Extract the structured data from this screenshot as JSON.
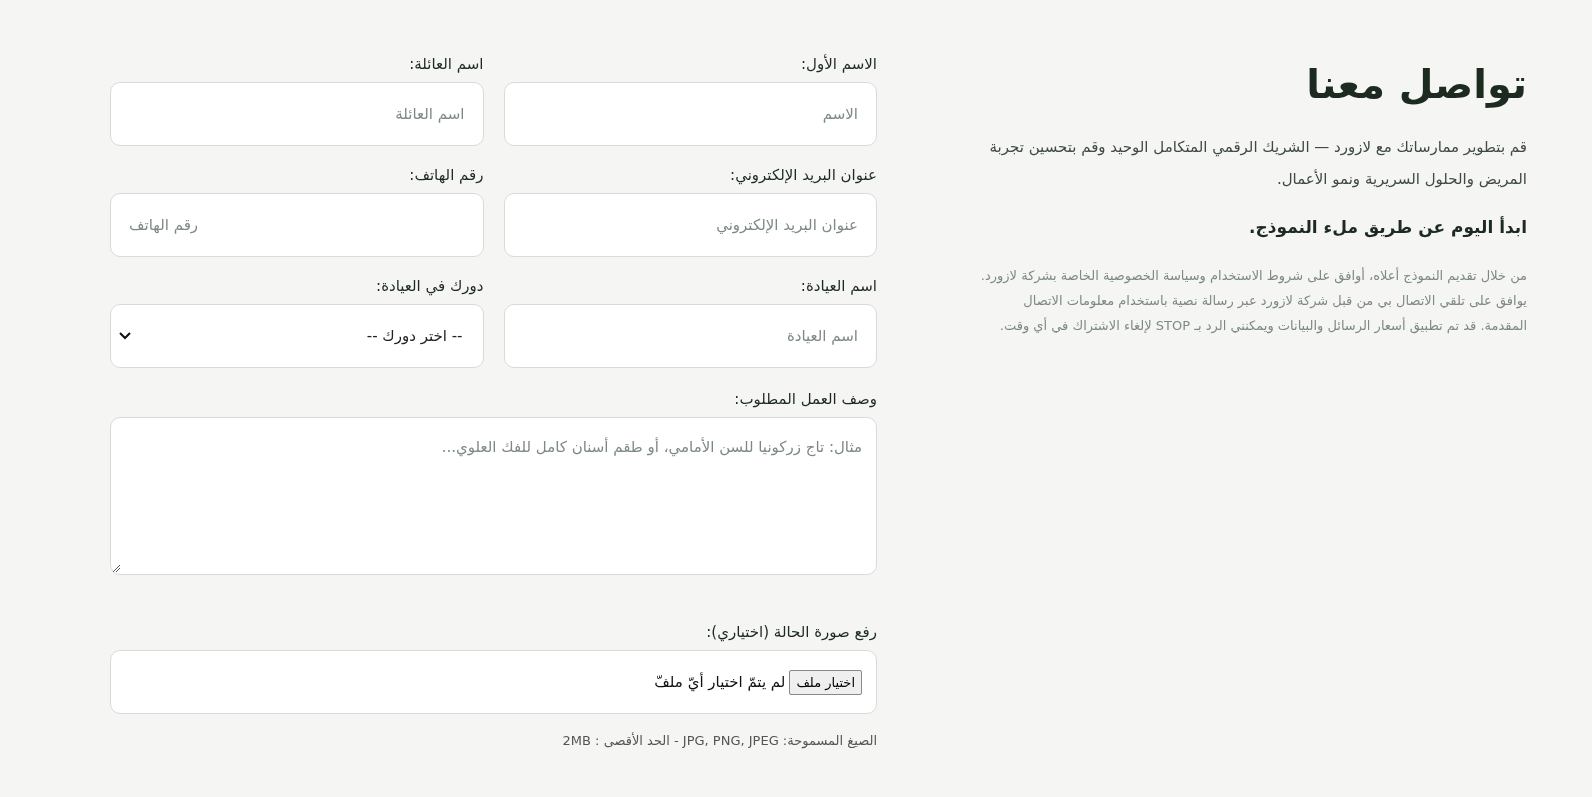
{
  "info": {
    "title": "تواصل معنا",
    "intro": "قم بتطوير ممارساتك مع لازورد — الشريك الرقمي المتكامل الوحيد وقم بتحسين تجربة المريض والحلول السريرية ونمو الأعمال.",
    "subtitle": "ابدأ اليوم عن طريق ملء النموذج.",
    "consent": "من خلال تقديم النموذج أعلاه، أوافق على شروط الاستخدام وسياسة الخصوصية الخاصة بشركة لازورد. يوافق على تلقي الاتصال بي من قبل شركة لازورد عبر رسالة نصية باستخدام معلومات الاتصال المقدمة. قد تم تطبيق أسعار الرسائل والبيانات ويمكنني الرد بـ STOP لإلغاء الاشتراك في أي وقت."
  },
  "fields": [
    {
      "kind": "text",
      "label": "الاسم الأول:",
      "placeholder": "الاسم"
    },
    {
      "kind": "text",
      "label": "اسم العائلة:",
      "placeholder": "اسم العائلة"
    },
    {
      "kind": "text",
      "label": "عنوان البريد الإلكتروني:",
      "placeholder": "عنوان البريد الإلكتروني"
    },
    {
      "kind": "phone",
      "label": "رقم الهاتف:",
      "placeholder": "رقم الهاتف"
    },
    {
      "kind": "text",
      "label": "اسم العيادة:",
      "placeholder": "اسم العيادة"
    },
    {
      "kind": "select",
      "label": "دورك في العيادة:",
      "value": "-- اختر دورك --"
    }
  ],
  "description": {
    "label": "وصف العمل المطلوب:",
    "placeholder": "مثال: تاج زركونيا للسن الأمامي، أو طقم أسنان كامل للفك العلوي..."
  },
  "upload": {
    "label": "رفع صورة الحالة (اختياري):",
    "button": "اختيار ملف",
    "status": "لم يتمّ اختيار أيّ ملفّ",
    "hint": "الصيغ المسموحة: JPG, PNG, JPEG - الحد الأقصى : 2MB"
  }
}
